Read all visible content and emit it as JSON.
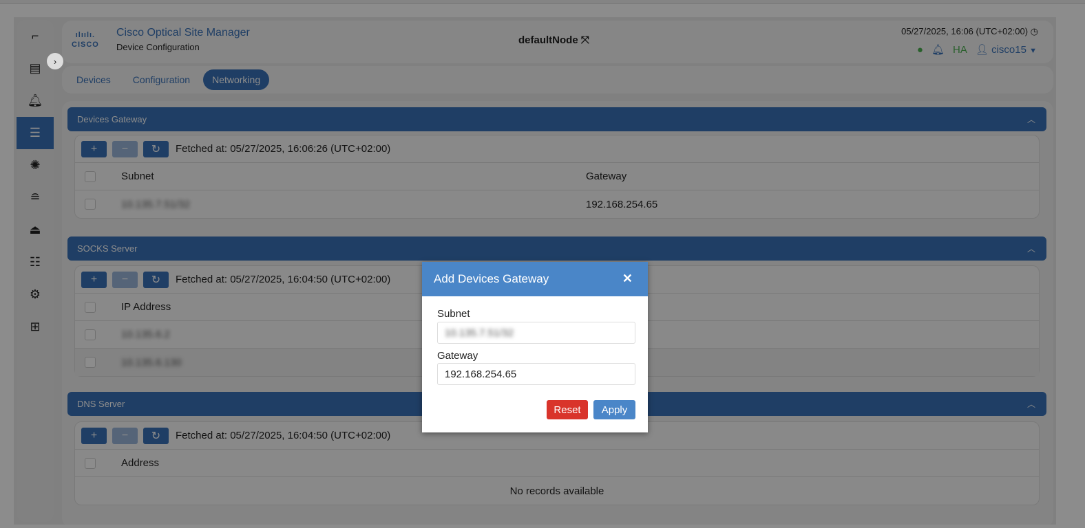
{
  "app": {
    "title": "Cisco Optical Site Manager",
    "subtitle": "Device Configuration",
    "logo": "CISCO",
    "node": "defaultNode",
    "datetime": "05/27/2025, 16:06 (UTC+02:00)",
    "ha": "HA",
    "user": "cisco15"
  },
  "sidebar": [
    "route-icon",
    "rack-icon",
    "alarm-icon",
    "device-config-icon",
    "fiber-icon",
    "database-icon",
    "upload-icon",
    "list-icon",
    "user-settings-icon",
    "add-icon"
  ],
  "tabs": [
    "Devices",
    "Configuration",
    "Networking"
  ],
  "sections": {
    "gateway": {
      "title": "Devices Gateway",
      "fetched": "Fetched at: 05/27/2025, 16:06:26 (UTC+02:00)",
      "col1": "Subnet",
      "col2": "Gateway",
      "rows": [
        {
          "subnet": "10.135.7.51/32",
          "gateway": "192.168.254.65"
        }
      ]
    },
    "socks": {
      "title": "SOCKS Server",
      "fetched": "Fetched at: 05/27/2025, 16:04:50 (UTC+02:00)",
      "col1": "IP Address",
      "rows": [
        "10.135.6.2",
        "10.135.6.130"
      ]
    },
    "dns": {
      "title": "DNS Server",
      "fetched": "Fetched at: 05/27/2025, 16:04:50 (UTC+02:00)",
      "col1": "Address",
      "empty": "No records available"
    }
  },
  "dialog": {
    "title": "Add Devices Gateway",
    "subnet_label": "Subnet",
    "subnet_value": "10.135.7.51/32",
    "gateway_label": "Gateway",
    "gateway_value": "192.168.254.65",
    "reset": "Reset",
    "apply": "Apply"
  },
  "colors": {
    "primary": "#3a72b8",
    "reset": "#d9342b",
    "ok": "#4caf50"
  }
}
